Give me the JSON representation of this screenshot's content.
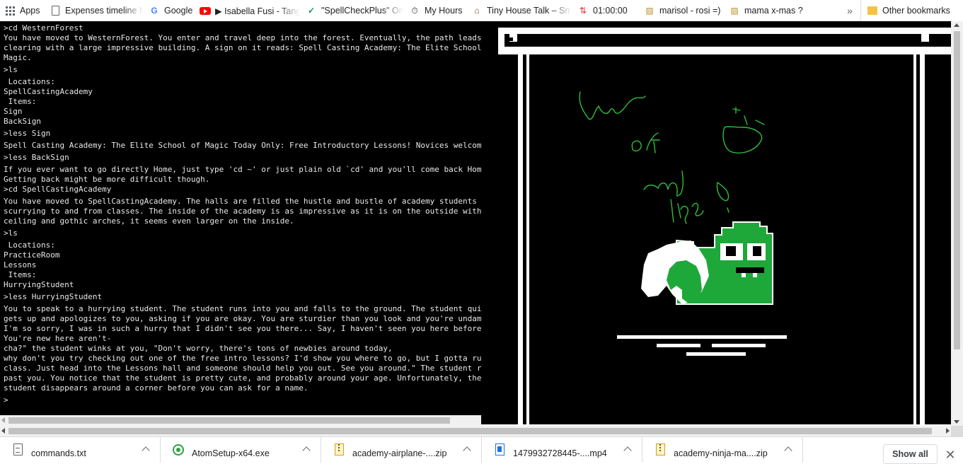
{
  "bookmarks": {
    "items": [
      {
        "label": "Apps",
        "icon": "apps-grid-icon"
      },
      {
        "label": "Expenses timeline Ma",
        "icon": "document-icon"
      },
      {
        "label": "Google",
        "icon": "google-icon"
      },
      {
        "label": "Isabella Fusi - Tang",
        "icon": "youtube-icon"
      },
      {
        "label": "\"SpellCheckPlus\" Onl",
        "icon": "spellcheck-icon"
      },
      {
        "label": "My Hours",
        "icon": "stopwatch-icon"
      },
      {
        "label": "Tiny House Talk – Sm",
        "icon": "house-icon"
      },
      {
        "label": "01:00:00",
        "icon": "timer-icon"
      },
      {
        "label": "marisol - rosi =)",
        "icon": "pattern-icon"
      },
      {
        "label": "mama x-mas ?",
        "icon": "pattern-icon"
      }
    ],
    "overflow": "»",
    "other": "Other bookmarks"
  },
  "terminal": {
    "lines": [
      {
        "text": ">cd WesternForest",
        "kind": "cmd"
      },
      {
        "text": "You have moved to WesternForest. You enter and travel deep into the forest. Eventually, the path leads",
        "kind": "out"
      },
      {
        "text": "clearing with a large impressive building. A sign on it reads: Spell Casting Academy: The Elite School",
        "kind": "out"
      },
      {
        "text": "Magic.",
        "kind": "out"
      },
      {
        "text": ">ls",
        "kind": "cmd"
      },
      {
        "text": " Locations:",
        "kind": "cmd"
      },
      {
        "text": "SpellCastingAcademy",
        "kind": "out"
      },
      {
        "text": " Items:",
        "kind": "out"
      },
      {
        "text": "Sign",
        "kind": "out"
      },
      {
        "text": "BackSign",
        "kind": "out"
      },
      {
        "text": ">less Sign",
        "kind": "cmd"
      },
      {
        "text": "Spell Casting Academy: The Elite School of Magic Today Only: Free Introductory Lessons! Novices welcome",
        "kind": "cmd"
      },
      {
        "text": ">less BackSign",
        "kind": "cmd"
      },
      {
        "text": "If you ever want to go directly Home, just type 'cd ~' or just plain old `cd' and you'll come back Home",
        "kind": "cmd"
      },
      {
        "text": "Getting back might be more difficult though.",
        "kind": "out"
      },
      {
        "text": ">cd SpellCastingAcademy",
        "kind": "out"
      },
      {
        "text": "You have moved to SpellCastingAcademy. The halls are filled the hustle and bustle of academy students",
        "kind": "cmd"
      },
      {
        "text": "scurrying to and from classes. The inside of the academy is as impressive as it is on the outside with",
        "kind": "out"
      },
      {
        "text": "ceiling and gothic arches, it seems even larger on the inside.",
        "kind": "out"
      },
      {
        "text": ">ls",
        "kind": "cmd"
      },
      {
        "text": " Locations:",
        "kind": "cmd"
      },
      {
        "text": "PracticeRoom",
        "kind": "out"
      },
      {
        "text": "Lessons",
        "kind": "out"
      },
      {
        "text": " Items:",
        "kind": "out"
      },
      {
        "text": "HurryingStudent",
        "kind": "out"
      },
      {
        "text": ">less HurryingStudent",
        "kind": "cmd"
      },
      {
        "text": "You to speak to a hurrying student. The student runs into you and falls to the ground. The student quic",
        "kind": "cmd"
      },
      {
        "text": "gets up and apologizes to you, asking if you are okay. You are sturdier than you look and you're undama",
        "kind": "out"
      },
      {
        "text": "I'm so sorry, I was in such a hurry that I didn't see you there... Say, I haven't seen you here before",
        "kind": "out"
      },
      {
        "text": "You're new here aren't-",
        "kind": "out"
      },
      {
        "text": "cha?\" the student winks at you, \"Don't worry, there's tons of newbies around today,",
        "kind": "out"
      },
      {
        "text": "why don't you try checking out one of the free intro lessons? I'd show you where to go, but I gotta run",
        "kind": "out"
      },
      {
        "text": "class. Just head into the Lessons hall and someone should help you out. See you around.\" The student ru",
        "kind": "out"
      },
      {
        "text": "past you. You notice that the student is pretty cute, and probably around your age. Unfortunately, the",
        "kind": "out"
      },
      {
        "text": "student disappears around a corner before you can ask for a name.",
        "kind": "out"
      },
      {
        "text": ">",
        "kind": "prompt"
      }
    ]
  },
  "game": {
    "doodle_text": "love of my life",
    "colors": {
      "background": "#000000",
      "frame": "#ffffff",
      "creature": "#1fa83a",
      "doodle": "#2fbf3a"
    }
  },
  "downloads": {
    "items": [
      {
        "label": "commands.txt",
        "icon": "text-file-icon"
      },
      {
        "label": "AtomSetup-x64.exe",
        "icon": "atom-installer-icon"
      },
      {
        "label": "academy-airplane-....zip",
        "icon": "zip-file-icon"
      },
      {
        "label": "1479932728445-....mp4",
        "icon": "video-file-icon"
      },
      {
        "label": "academy-ninja-ma....zip",
        "icon": "zip-file-icon"
      }
    ],
    "show_all": "Show all",
    "close": "✕"
  }
}
